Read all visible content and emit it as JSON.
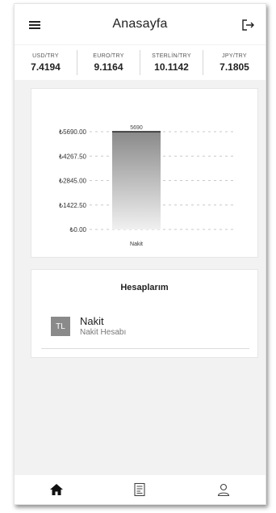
{
  "header": {
    "title": "Anasayfa"
  },
  "rates": [
    {
      "label": "USD/TRY",
      "value": "7.4194"
    },
    {
      "label": "EURO/TRY",
      "value": "9.1164"
    },
    {
      "label": "STERLİN/TRY",
      "value": "10.1142"
    },
    {
      "label": "JPY/TRY",
      "value": "7.1805"
    }
  ],
  "chart_data": {
    "type": "bar",
    "categories": [
      "Nakit"
    ],
    "values": [
      5690
    ],
    "data_labels": [
      "5690"
    ],
    "y_ticks": [
      "₺5690.00",
      "₺4267.50",
      "₺2845.00",
      "₺1422.50",
      "₺0.00"
    ],
    "ylim": [
      0,
      5690
    ],
    "grid": true,
    "colors": {
      "bar_top": "#8a8a8a",
      "bar_bottom": "#f0f0f0",
      "bar_line": "#222222"
    }
  },
  "accounts": {
    "title": "Hesaplarım",
    "items": [
      {
        "avatar": "TL",
        "name": "Nakit",
        "subtitle": "Nakit Hesabı"
      }
    ]
  },
  "nav": {
    "items": [
      {
        "icon": "home-icon"
      },
      {
        "icon": "document-icon"
      },
      {
        "icon": "user-icon"
      }
    ]
  }
}
